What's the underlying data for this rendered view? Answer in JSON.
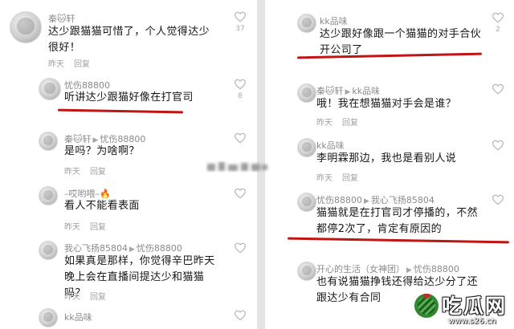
{
  "left_comments": [
    {
      "user": "秦🐱轩",
      "reply_to": "",
      "text": "达少跟猫猫可惜了，个人觉得达少很好！",
      "time": "昨天",
      "reply": "回复",
      "likes": "37"
    },
    {
      "user": "忧伤88800",
      "reply_to": "",
      "text": "听讲达少跟猫好像在打官司",
      "time": "",
      "reply": "",
      "likes": "8"
    },
    {
      "user": "秦🐱轩",
      "reply_to": "忧伤88800",
      "text": "是吗？为啥啊？",
      "time": "昨天",
      "reply": "回复",
      "likes": ""
    },
    {
      "user": "–哎哟喂–🔥",
      "reply_to": "",
      "text": "看人不能看表面",
      "time": "昨天",
      "reply": "回复",
      "likes": ""
    },
    {
      "user": "我心飞扬85804",
      "reply_to": "忧伤88800",
      "text": "如果真是那样，你觉得辛巴昨天晚上会在直播间提达少和猫猫吗？",
      "time": "昨天",
      "reply": "回复",
      "likes": ""
    },
    {
      "user": "kk品味",
      "reply_to": "",
      "text": "",
      "time": "",
      "reply": "",
      "likes": ""
    }
  ],
  "right_comments": [
    {
      "user": "kk品味",
      "reply_to": "",
      "text": "达少跟好像跟一个猫猫的对手合伙开公司了",
      "time": "",
      "reply": "",
      "likes": "2"
    },
    {
      "user": "秦🐱轩",
      "reply_to": "kk品味",
      "text": "哦！我在想猫猫对手会是谁？",
      "time": "昨天",
      "reply": "回复",
      "likes": ""
    },
    {
      "user": "kk品味",
      "reply_to": "",
      "text": "李明霖那边，我也是看别人说",
      "time": "昨天",
      "reply": "回复",
      "likes": ""
    },
    {
      "user": "忧伤88800",
      "reply_to": "我心飞扬85804",
      "text": "猫猫就是在打官司才停播的，不然都停2次了，肯定有原因的",
      "time": "",
      "reply": "",
      "likes": ""
    },
    {
      "user": "开心的生活（女神团）",
      "reply_to": "忧伤88800",
      "text": "也有说猫猫挣钱还得给达少分了还跟达少有合同",
      "time": "",
      "reply": "",
      "likes": ""
    }
  ],
  "watermark": {
    "title": "吃瓜网",
    "url": "www.s26.cn"
  },
  "colors": {
    "highlight": "#c01515",
    "background": "#ffffff",
    "username": "#8a8a8a"
  }
}
